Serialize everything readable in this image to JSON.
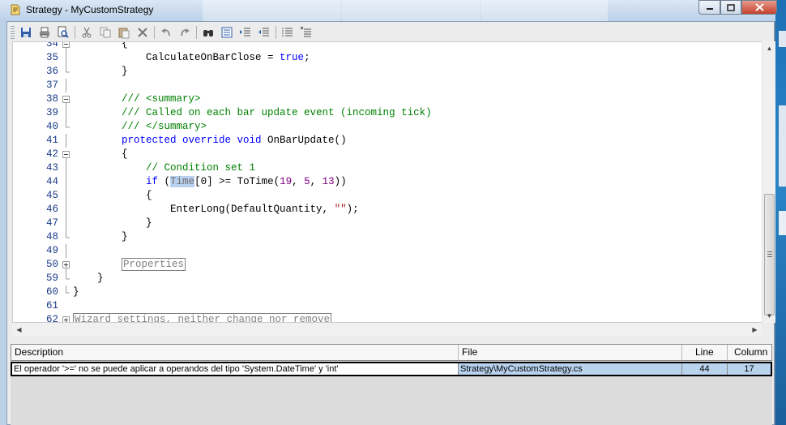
{
  "window": {
    "title": "Strategy - MyCustomStrategy"
  },
  "toolbar": {
    "icons": [
      "save-icon",
      "print-icon",
      "print-preview-icon",
      "cut-icon",
      "copy-icon",
      "paste-icon",
      "delete-icon",
      "undo-icon",
      "redo-icon",
      "find-icon",
      "find-replace-icon",
      "indent-icon",
      "outdent-icon",
      "comment-icon",
      "uncomment-icon"
    ]
  },
  "editor": {
    "lines": [
      {
        "n": "34",
        "fold": "minus",
        "parts": [
          [
            "",
            "        {"
          ]
        ]
      },
      {
        "n": "35",
        "fold": "bar",
        "parts": [
          [
            "",
            "            CalculateOnBarClose = "
          ],
          [
            "kw",
            "true"
          ],
          [
            "",
            ";"
          ]
        ]
      },
      {
        "n": "36",
        "fold": "end",
        "parts": [
          [
            "",
            "        }"
          ]
        ]
      },
      {
        "n": "37",
        "fold": "bar",
        "parts": [
          [
            "",
            ""
          ]
        ]
      },
      {
        "n": "38",
        "fold": "minus",
        "parts": [
          [
            "cm",
            "        /// <summary>"
          ]
        ]
      },
      {
        "n": "39",
        "fold": "bar",
        "parts": [
          [
            "cm",
            "        /// Called on each bar update event (incoming tick)"
          ]
        ]
      },
      {
        "n": "40",
        "fold": "end",
        "parts": [
          [
            "cm",
            "        /// </summary>"
          ]
        ]
      },
      {
        "n": "41",
        "fold": "bar",
        "parts": [
          [
            "",
            "        "
          ],
          [
            "kw",
            "protected override void"
          ],
          [
            "",
            " OnBarUpdate()"
          ]
        ]
      },
      {
        "n": "42",
        "fold": "minus",
        "parts": [
          [
            "",
            "        {"
          ]
        ]
      },
      {
        "n": "43",
        "fold": "bar",
        "parts": [
          [
            "cm",
            "            // Condition set 1"
          ]
        ]
      },
      {
        "n": "44",
        "fold": "bar",
        "parts": [
          [
            "",
            "            "
          ],
          [
            "kw",
            "if"
          ],
          [
            "",
            " ("
          ],
          [
            "hl",
            "Time"
          ],
          [
            "",
            "[0] >= ToTime("
          ],
          [
            "nm",
            "19"
          ],
          [
            "",
            ", "
          ],
          [
            "nm",
            "5"
          ],
          [
            "",
            ", "
          ],
          [
            "nm",
            "13"
          ],
          [
            "",
            "))"
          ]
        ]
      },
      {
        "n": "45",
        "fold": "bar",
        "parts": [
          [
            "",
            "            {"
          ]
        ]
      },
      {
        "n": "46",
        "fold": "bar",
        "parts": [
          [
            "",
            "                EnterLong(DefaultQuantity, "
          ],
          [
            "st",
            "\"\""
          ],
          [
            "",
            ");"
          ]
        ]
      },
      {
        "n": "47",
        "fold": "bar",
        "parts": [
          [
            "",
            "            }"
          ]
        ]
      },
      {
        "n": "48",
        "fold": "end",
        "parts": [
          [
            "",
            "        }"
          ]
        ]
      },
      {
        "n": "49",
        "fold": "bar",
        "parts": [
          [
            "",
            ""
          ]
        ]
      },
      {
        "n": "50",
        "fold": "plus",
        "parts": [
          [
            "",
            "        "
          ],
          [
            "boxed",
            "Properties"
          ]
        ]
      },
      {
        "n": "59",
        "fold": "end",
        "parts": [
          [
            "",
            "    }"
          ]
        ]
      },
      {
        "n": "60",
        "fold": "end",
        "parts": [
          [
            "",
            "}"
          ]
        ]
      },
      {
        "n": "61",
        "fold": "none",
        "parts": [
          [
            "",
            ""
          ]
        ]
      },
      {
        "n": "62",
        "fold": "plus",
        "parts": [
          [
            "boxed",
            "Wizard settings, neither change nor remove"
          ]
        ]
      }
    ]
  },
  "errors": {
    "columns": {
      "description": "Description",
      "file": "File",
      "line": "Line",
      "column": "Column"
    },
    "rows": [
      {
        "description": "El operador '>=' no se puede aplicar a operandos del tipo 'System.DateTime' y 'int'",
        "file": "Strategy\\MyCustomStrategy.cs",
        "line": "44",
        "column": "17"
      }
    ]
  },
  "colors": {
    "keyword": "#0000ff",
    "comment": "#008000",
    "string": "#a31515",
    "number": "#800080",
    "selection": "#b9d1f0"
  }
}
